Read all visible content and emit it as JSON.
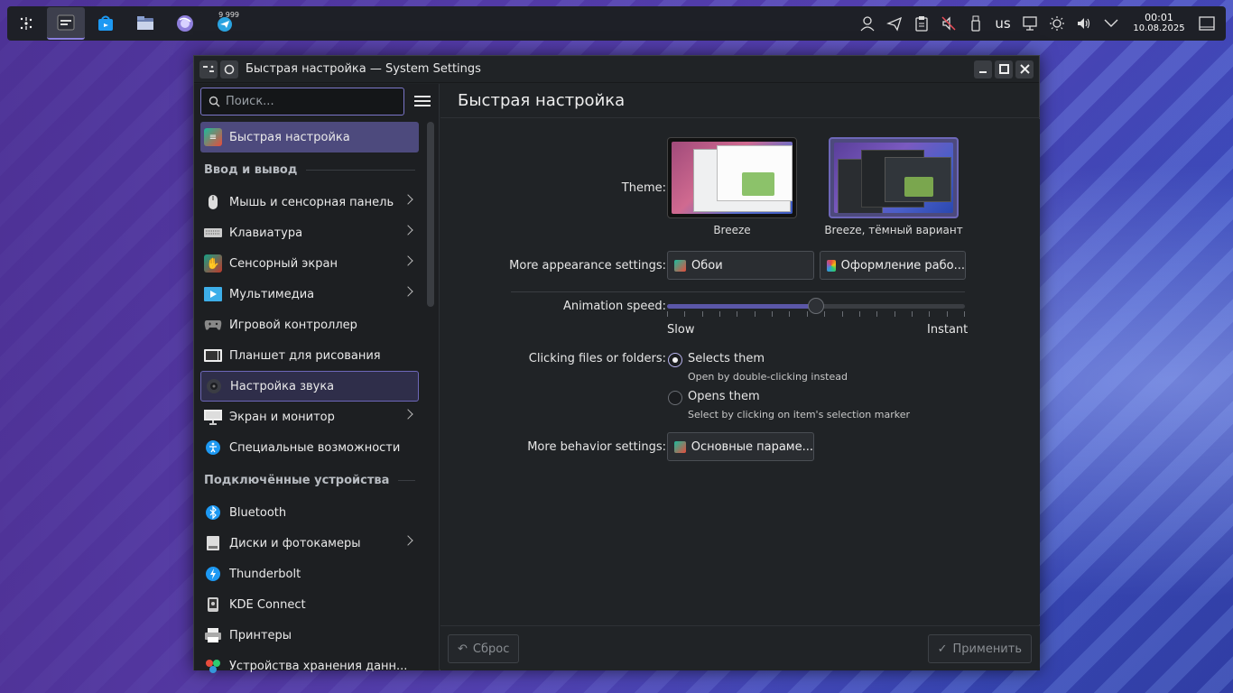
{
  "taskbar": {
    "launcher_icon": "kde-launcher-icon",
    "apps": [
      {
        "name": "system-settings-app-icon",
        "active": true
      },
      {
        "name": "discover-store-app-icon",
        "active": false
      },
      {
        "name": "dolphin-files-app-icon",
        "active": false
      },
      {
        "name": "firefox-browser-app-icon",
        "active": false
      },
      {
        "name": "telegram-app-icon",
        "active": false,
        "badge": "9 999"
      }
    ],
    "tray": {
      "keyboard_layout": "us",
      "time": "00:01",
      "date": "10.08.2025"
    }
  },
  "window": {
    "title": "Быстрая настройка — System Settings"
  },
  "sidebar": {
    "search_placeholder": "Поиск...",
    "items": [
      {
        "label": "Быстрая настройка",
        "selected": true
      },
      {
        "header": "Ввод и вывод"
      },
      {
        "label": "Мышь и сенсорная панель",
        "chevron": true
      },
      {
        "label": "Клавиатура",
        "chevron": true
      },
      {
        "label": "Сенсорный экран",
        "chevron": true
      },
      {
        "label": "Мультимедиа",
        "chevron": true
      },
      {
        "label": "Игровой контроллер"
      },
      {
        "label": "Планшет для рисования"
      },
      {
        "label": "Настройка звука",
        "hover": true
      },
      {
        "label": "Экран и монитор",
        "chevron": true
      },
      {
        "label": "Специальные возможности"
      },
      {
        "header": "Подключённые устройства"
      },
      {
        "label": "Bluetooth"
      },
      {
        "label": "Диски и фотокамеры",
        "chevron": true
      },
      {
        "label": "Thunderbolt"
      },
      {
        "label": "KDE Connect"
      },
      {
        "label": "Принтеры"
      },
      {
        "label": "Устройства хранения данн..."
      }
    ]
  },
  "main": {
    "title": "Быстрая настройка",
    "theme_label": "Theme:",
    "themes": [
      {
        "name": "Breeze"
      },
      {
        "name": "Breeze, тёмный вариант"
      }
    ],
    "appearance_label": "More appearance settings:",
    "wallpaper_button": "Обои",
    "workspace_button": "Оформление рабо...",
    "animation_label": "Animation speed:",
    "animation_slow": "Slow",
    "animation_instant": "Instant",
    "animation_value": 0.5,
    "clicking_label": "Clicking files or folders:",
    "option_selects": "Selects them",
    "option_selects_hint": "Open by double-clicking instead",
    "option_opens": "Opens them",
    "option_opens_hint": "Select by clicking on item's selection marker",
    "behavior_label": "More behavior settings:",
    "behavior_button": "Основные параме..."
  },
  "footer": {
    "reset": "Сброс",
    "apply": "Применить"
  },
  "colors": {
    "accent": "#6d67b8",
    "selection": "#4d4a7d",
    "window_bg": "#202326"
  }
}
